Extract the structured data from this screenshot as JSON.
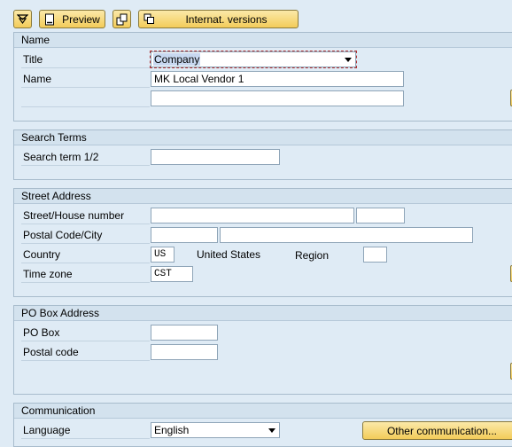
{
  "toolbar": {
    "expand_icon": "expand-collapse-icon",
    "preview_label": "Preview",
    "copy_icon": "copy-icon",
    "internat_label": "Internat. versions"
  },
  "name_group": {
    "title": "Name",
    "title_label": "Title",
    "title_value": "Company",
    "name_label": "Name",
    "name_value": "MK Local Vendor 1",
    "name2_value": ""
  },
  "search_group": {
    "title": "Search Terms",
    "search_label": "Search term 1/2",
    "search_value": ""
  },
  "street_group": {
    "title": "Street Address",
    "street_label": "Street/House number",
    "street_value": "",
    "house_value": "",
    "postal_label": "Postal Code/City",
    "postal_value": "",
    "city_value": "",
    "country_label": "Country",
    "country_value": "US",
    "country_name": "United States",
    "region_label": "Region",
    "region_value": "",
    "tz_label": "Time zone",
    "tz_value": "CST"
  },
  "pobox_group": {
    "title": "PO Box Address",
    "pobox_label": "PO Box",
    "pobox_value": "",
    "pcode_label": "Postal code",
    "pcode_value": ""
  },
  "comm_group": {
    "title": "Communication",
    "lang_label": "Language",
    "lang_value": "English",
    "other_comm_label": "Other communication..."
  }
}
